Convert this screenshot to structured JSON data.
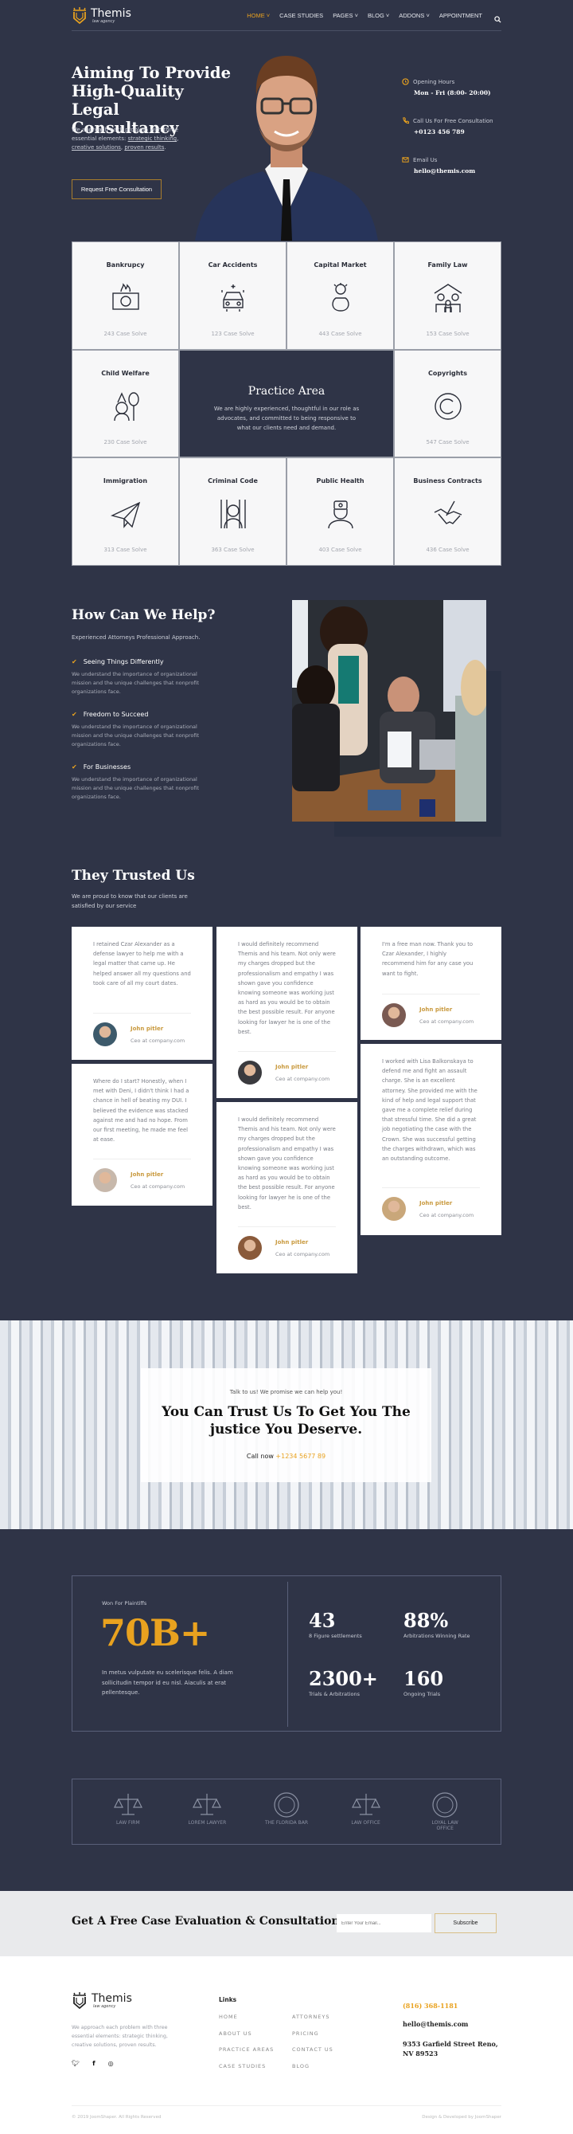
{
  "header": {
    "logo": {
      "name": "Themis",
      "tagline": "law agency"
    },
    "nav": [
      {
        "label": "HOME",
        "dropdown": true,
        "active": true
      },
      {
        "label": "CASE STUDIES",
        "dropdown": false
      },
      {
        "label": "PAGES",
        "dropdown": true
      },
      {
        "label": "BLOG",
        "dropdown": true
      },
      {
        "label": "ADDONS",
        "dropdown": true
      },
      {
        "label": "APPOINTMENT",
        "dropdown": false
      }
    ],
    "search_icon": "search-icon"
  },
  "hero": {
    "title": "Aiming To Provide High-Quality Legal Consultancy",
    "desc_prefix": "We approach each problem with three essential elements: ",
    "desc_links": [
      "strategic thinking",
      "creative solutions",
      "proven results"
    ],
    "button": "Request Free Consultation",
    "info": [
      {
        "icon": "clock-icon",
        "label": "Opening Hours",
        "value": "Mon - Fri (8:00- 20:00)"
      },
      {
        "icon": "phone-icon",
        "label": "Call Us For Free Consultation",
        "value": "+0123 456 789"
      },
      {
        "icon": "mail-icon",
        "label": "Email Us",
        "value": "hello@themis.com"
      }
    ]
  },
  "practice": {
    "title": "Practice Area",
    "desc": "We are highly experienced, thoughtful in our role as advocates, and committed to being responsive to what our clients need and demand.",
    "items": [
      {
        "title": "Bankrupcy",
        "count": "243 Case Solve",
        "icon": "money-fire"
      },
      {
        "title": "Car Accidents",
        "count": "123 Case Solve",
        "icon": "car"
      },
      {
        "title": "Capital Market",
        "count": "443 Case Solve",
        "icon": "money-bag"
      },
      {
        "title": "Family Law",
        "count": "153 Case Solve",
        "icon": "family-house"
      },
      {
        "title": "Child Welfare",
        "count": "230 Case Solve",
        "icon": "child-balloon"
      },
      {
        "title": "Copyrights",
        "count": "547 Case Solve",
        "icon": "copyright"
      },
      {
        "title": "Immigration",
        "count": "313 Case Solve",
        "icon": "paper-plane"
      },
      {
        "title": "Criminal Code",
        "count": "363 Case Solve",
        "icon": "prisoner"
      },
      {
        "title": "Public Health",
        "count": "403 Case Solve",
        "icon": "doctor"
      },
      {
        "title": "Business Contracts",
        "count": "436 Case Solve",
        "icon": "handshake"
      }
    ]
  },
  "help": {
    "title": "How Can We Help?",
    "subtitle": "Experienced Attorneys Professional Approach.",
    "items": [
      {
        "title": "Seeing Things Differently",
        "desc": "We understand the importance of organizational mission and the unique challenges that nonprofit organizations face."
      },
      {
        "title": "Freedom to Succeed",
        "desc": "We understand the importance of organizational mission and the unique challenges that nonprofit organizations face."
      },
      {
        "title": "For Businesses",
        "desc": "We understand the importance of organizational mission and the unique challenges that nonprofit organizations face."
      }
    ]
  },
  "testimonials": {
    "title": "They Trusted Us",
    "subtitle": "We are proud to know that our clients are satisfied by our service",
    "cards": [
      {
        "quote": "I retained Czar Alexander as a defense lawyer to help me with a legal matter that came up. He helped answer all my questions and took care of all my court dates.",
        "name": "John pitler",
        "role": "Ceo at company.com",
        "avatar_color": "#3d5a6b"
      },
      {
        "quote": "Where do I start? Honestly, when I met with Deni, I didn't think I had a chance in hell of beating my DUI. I believed the evidence was stacked against me and had no hope. From our first meeting, he made me feel at ease.",
        "name": "John pitler",
        "role": "Ceo at company.com",
        "avatar_color": "#c7b8ab"
      },
      {
        "quote": "I would definitely recommend Themis and his team. Not only were my charges dropped but the professionalism and empathy I was shown gave you confidence knowing someone was working just as hard as you would be to obtain the best possible result. For anyone looking for lawyer he is one of the best.",
        "name": "John pitler",
        "role": "Ceo at company.com",
        "avatar_color": "#3a3a3e"
      },
      {
        "quote": "I would definitely recommend Themis and his team. Not only were my charges dropped but the professionalism and empathy I was shown gave you confidence knowing someone was working just as hard as you would be to obtain the best possible result. For anyone looking for lawyer he is one of the best.",
        "name": "John pitler",
        "role": "Ceo at company.com",
        "avatar_color": "#8a5a3a"
      },
      {
        "quote": "I'm a free man now. Thank you to Czar Alexander, I highly recommend him for any case you want to fight.",
        "name": "John pitler",
        "role": "Ceo at company.com",
        "avatar_color": "#7a5a52"
      },
      {
        "quote": "I worked with Lisa Balkonskaya to defend me and fight an assault charge. She is an excellent attorney. She provided me with the kind of help and legal support that gave me a complete relief during that stressful time. She did a great job negotiating the case with the Crown. She was successful getting the charges withdrawn, which was an outstanding outcome.",
        "name": "John pitler",
        "role": "Ceo at company.com",
        "avatar_color": "#c9a77a"
      }
    ]
  },
  "cta": {
    "small": "Talk to us! We promise we can help you!",
    "title": "You Can Trust Us To Get You The justice You Deserve.",
    "call_label": "Call now",
    "phone": "+1234 5677 89"
  },
  "stats": {
    "won_label": "Won For Plaintiffs",
    "won_value": "70B+",
    "desc": "In metus vulputate eu scelerisque felis. A diam sollicitudin tempor id eu nisl. Aiaculis at erat pellentesque.",
    "items": [
      {
        "value": "43",
        "label": "8 Figure settlements"
      },
      {
        "value": "88%",
        "label": "Arbitrations Winning Rate"
      },
      {
        "value": "2300+",
        "label": "Trials & Arbitrations"
      },
      {
        "value": "160",
        "label": "Ongoing Trials"
      }
    ]
  },
  "partner_logos": [
    "LAW FIRM",
    "LOREM LAWYER",
    "THE FLORIDA BAR",
    "LAW OFFICE",
    "LOYAL LAW OFFICE"
  ],
  "newsletter": {
    "title": "Get A Free Case Evaluation & Consultation",
    "placeholder": "Enter Your Email...",
    "button": "Subscribe"
  },
  "footer": {
    "logo": {
      "name": "Themis",
      "tagline": "law agency"
    },
    "desc": "We approach each problem with three essential elements: strategic thinking, creative solutions, proven results.",
    "social": [
      "twitter-icon",
      "facebook-icon",
      "instagram-icon"
    ],
    "links_title": "Links",
    "links": [
      "HOME",
      "ATTORNEYS",
      "ABOUT US",
      "PRICING",
      "PRACTICE AREAS",
      "CONTACT US",
      "CASE STUDIES",
      "BLOG"
    ],
    "phone": "(816) 368-1181",
    "email": "hello@themis.com",
    "address": "9353 Garfield Street Reno, NV 89523",
    "copyright": "© 2019 JoomShaper. All Rights Reserved",
    "credit": "Design & Developed by JoomShaper"
  },
  "colors": {
    "navy": "#2f3447",
    "accent": "#e9a21f"
  }
}
